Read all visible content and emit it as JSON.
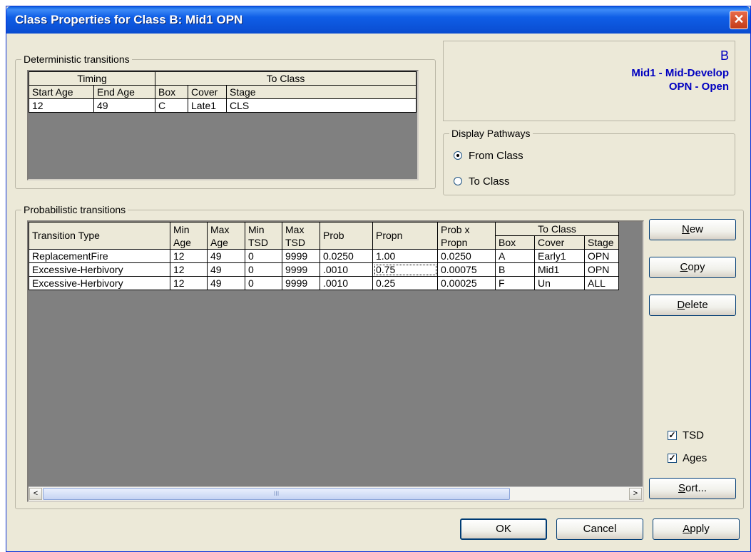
{
  "window": {
    "title": "Class Properties for Class B: Mid1 OPN",
    "close_glyph": "✕"
  },
  "deterministic": {
    "label": "Deterministic transitions",
    "group_headers": {
      "timing": "Timing",
      "to_class": "To Class"
    },
    "columns": [
      "Start Age",
      "End Age",
      "Box",
      "Cover",
      "Stage"
    ],
    "rows": [
      [
        "12",
        "49",
        "C",
        "Late1",
        "CLS"
      ]
    ]
  },
  "info": {
    "letter": "B",
    "line1": "Mid1 - Mid-Develop",
    "line2": "OPN - Open"
  },
  "display_pathways": {
    "label": "Display Pathways",
    "options": [
      {
        "label": "From Class",
        "selected": true
      },
      {
        "label": "To Class",
        "selected": false
      }
    ]
  },
  "probabilistic": {
    "label": "Probabilistic transitions",
    "group_headers": {
      "to_class": "To Class"
    },
    "columns": [
      {
        "top": "Transition Type",
        "bottom": ""
      },
      {
        "top": "Min",
        "bottom": "Age"
      },
      {
        "top": "Max",
        "bottom": "Age"
      },
      {
        "top": "Min",
        "bottom": "TSD"
      },
      {
        "top": "Max",
        "bottom": "TSD"
      },
      {
        "top": "Prob",
        "bottom": ""
      },
      {
        "top": "Propn",
        "bottom": ""
      },
      {
        "top": "Prob x",
        "bottom": "Propn"
      }
    ],
    "to_class_columns": [
      "Box",
      "Cover",
      "Stage"
    ],
    "rows": [
      [
        "ReplacementFire",
        "12",
        "49",
        "0",
        "9999",
        "0.0250",
        "1.00",
        "0.0250",
        "A",
        "Early1",
        "OPN"
      ],
      [
        "Excessive-Herbivory",
        "12",
        "49",
        "0",
        "9999",
        ".0010",
        "0.75",
        "0.00075",
        "B",
        "Mid1",
        "OPN"
      ],
      [
        "Excessive-Herbivory",
        "12",
        "49",
        "0",
        "9999",
        ".0010",
        "0.25",
        "0.00025",
        "F",
        "Un",
        "ALL"
      ]
    ],
    "scroll_left_glyph": "<",
    "scroll_right_glyph": ">",
    "scroll_thumb_grip": "III"
  },
  "side_buttons": {
    "new": {
      "mnemonic": "N",
      "rest": "ew"
    },
    "copy": {
      "mnemonic": "C",
      "rest": "opy"
    },
    "delete": {
      "mnemonic": "D",
      "rest": "elete"
    },
    "sort": {
      "mnemonic": "S",
      "rest": "ort..."
    }
  },
  "checkboxes": {
    "tsd": {
      "label": "TSD",
      "checked": true
    },
    "ages": {
      "label": "Ages",
      "checked": true
    },
    "check_glyph": "✓"
  },
  "footer": {
    "ok": "OK",
    "cancel": "Cancel",
    "apply": {
      "mnemonic": "A",
      "rest": "pply"
    }
  },
  "colors": {
    "title_bar": "#0a4cd0",
    "dialog_bg": "#ece9d8",
    "info_text": "#0000c0",
    "grid_empty": "#808080"
  }
}
